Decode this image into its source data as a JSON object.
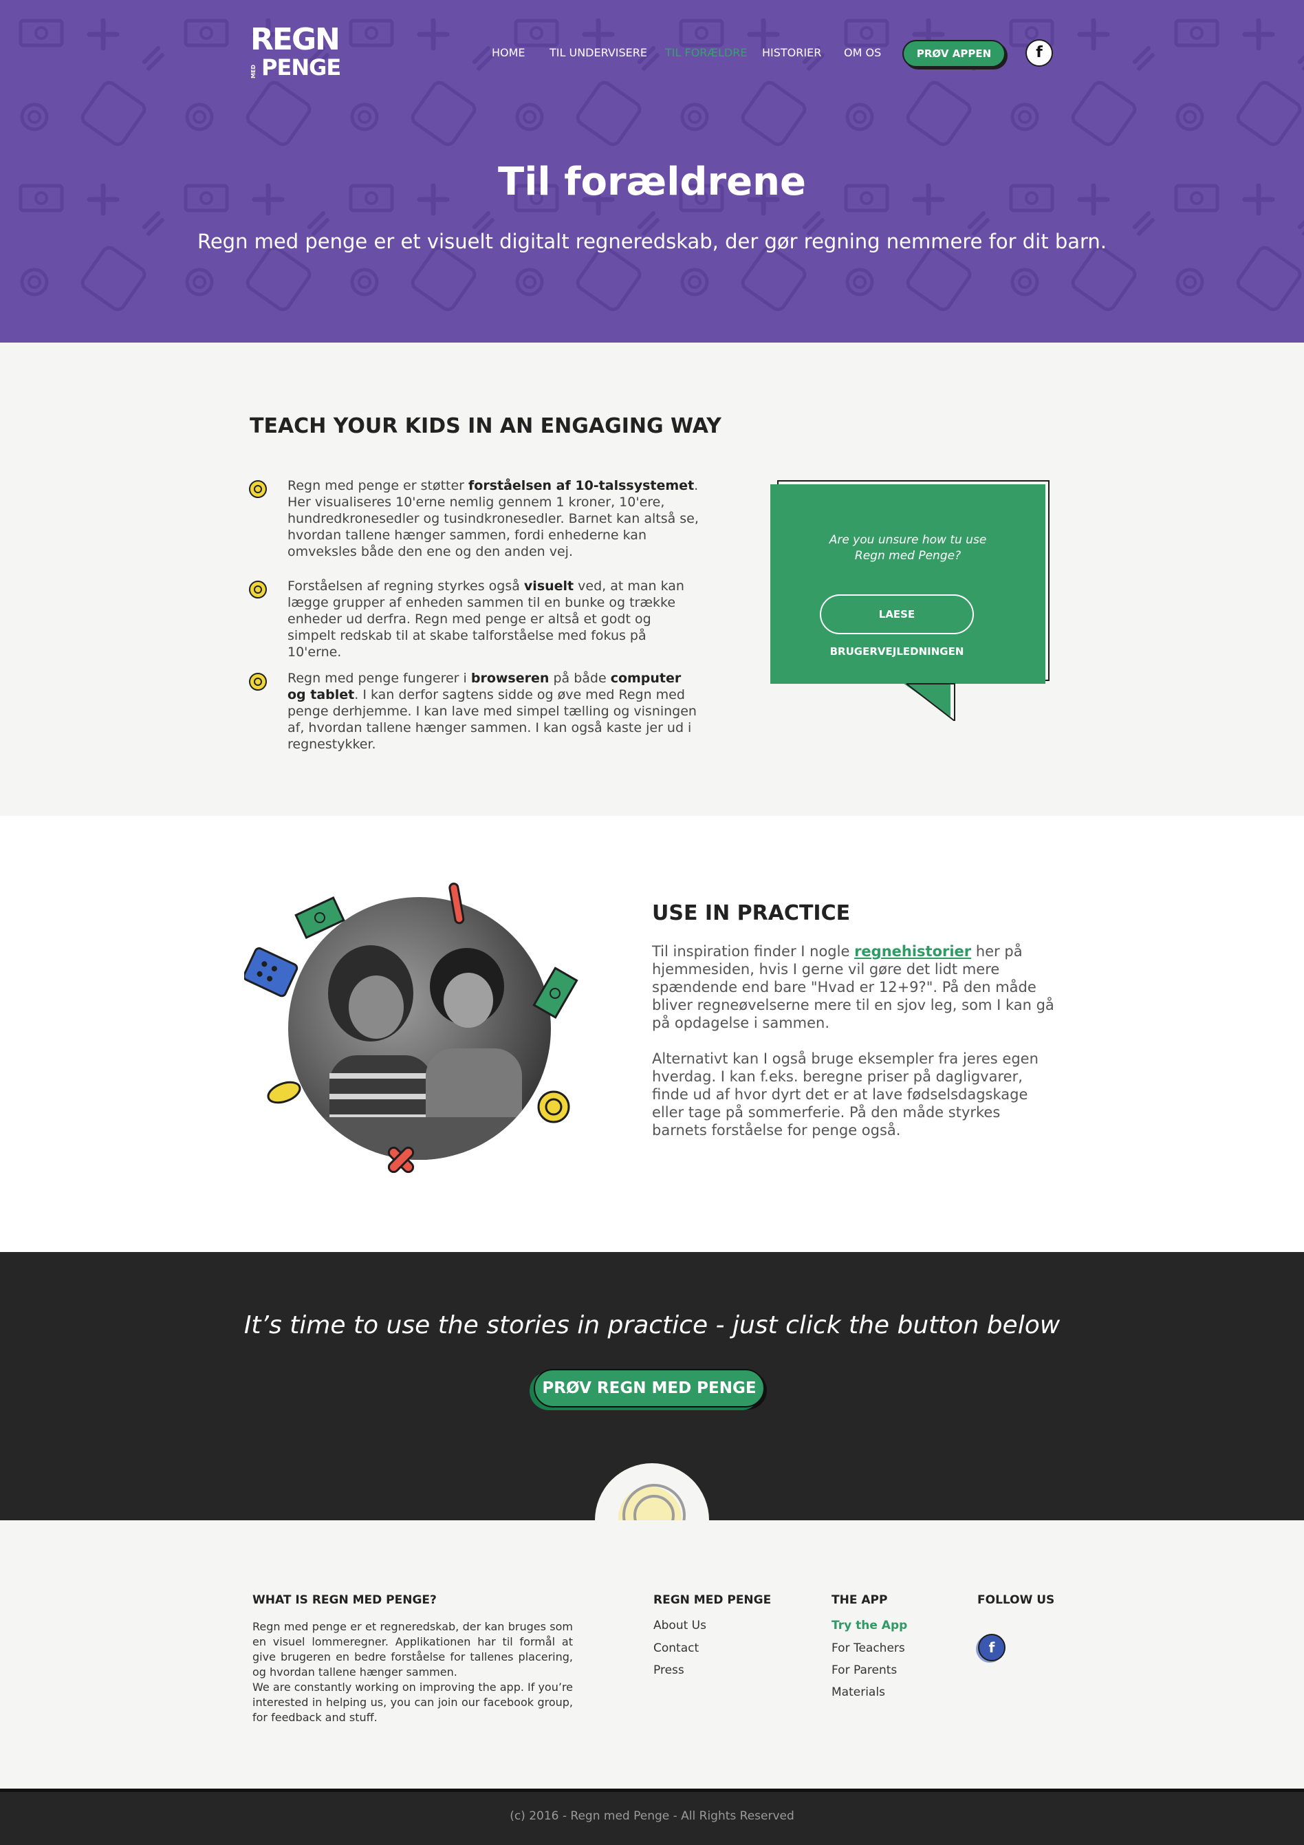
{
  "brand": {
    "logo_top": "REGN",
    "logo_small": "MED",
    "logo_bottom": "PENGE"
  },
  "nav": {
    "items": [
      {
        "label": "HOME",
        "active": false
      },
      {
        "label": "TIL UNDERVISERE",
        "active": false
      },
      {
        "label": "TIL FORÆLDRE",
        "active": true
      },
      {
        "label": "HISTORIER",
        "active": false
      },
      {
        "label": "OM OS",
        "active": false
      }
    ],
    "cta_label": "PRØV APPEN",
    "social_icon": "facebook-icon",
    "social_glyph": "f"
  },
  "hero": {
    "title": "Til forældrene",
    "subtitle": "Regn med penge er et visuelt digitalt regneredskab, der gør regning nemmere for dit barn."
  },
  "teach": {
    "heading": "TEACH YOUR KIDS IN AN ENGAGING WAY",
    "bullets": [
      {
        "pre": "Regn med penge er støtter ",
        "bold": "forståelsen af 10-talssystemet",
        "post": ". Her visualiseres 10'erne nemlig gennem 1 kroner, 10'ere, hundredkronesedler og tusindkronesedler.  Barnet kan altså se, hvordan tallene hænger sammen, fordi enhederne kan omveksles både den ene og den anden vej."
      },
      {
        "pre": "Forståelsen af regning styrkes også ",
        "bold": "visuelt",
        "post": " ved, at man kan lægge grupper af enheden sammen til en bunke og trække enheder ud derfra.  Regn med penge er altså et godt og simpelt redskab til at skabe talforståelse med fokus på 10'erne."
      },
      {
        "pre": "Regn med penge fungerer i ",
        "bold": "browseren",
        "mid": " på både ",
        "bold2": "computer og tablet",
        "post": ". I kan derfor sagtens sidde og øve med Regn med penge derhjemme. I kan lave med simpel tælling og visningen af, hvordan tallene hænger sammen. I kan også kaste jer ud i regnestykker."
      }
    ],
    "bubble_question_1": "Are you unsure how tu use",
    "bubble_question_2": "Regn med Penge?",
    "bubble_button": "LAESE BRUGERVEJLEDNINGEN"
  },
  "practice": {
    "heading": "USE IN PRACTICE",
    "p1_pre": "Til inspiration finder I nogle ",
    "p1_link": "regnehistorier",
    "p1_post": " her på hjemmesiden, hvis I gerne vil gøre det lidt mere spændende end bare \"Hvad er 12+9?\".  På den måde bliver regneøvelserne mere til en sjov leg, som I kan gå på opdagelse i sammen.",
    "p2": "Alternativt kan I også bruge eksempler fra jeres egen hverdag. I kan f.eks. beregne priser på dagligvarer, finde ud af hvor dyrt det er at lave fødselsdagskage eller tage på sommerferie. På den måde styrkes barnets forståelse for penge også."
  },
  "cta": {
    "text": "It’s time to use the stories in practice - just click the button below",
    "button": "PRØV REGN MED PENGE"
  },
  "footer": {
    "about_title": "WHAT IS REGN MED PENGE?",
    "about_text_1": "Regn med penge er et regneredskab, der kan bruges som en visuel lommeregner. Applikationen har til formål at give brugeren en bedre forståelse for tallenes placering, og hvordan tallene hænger sammen.",
    "about_text_2": "We are constantly working on improving the app. If you’re interested in helping us, you can join our facebook group, for feedback and stuff.",
    "col1_title": "REGN MED PENGE",
    "col1_links": [
      "About Us",
      "Contact",
      "Press"
    ],
    "col2_title": "THE APP",
    "col2_links": [
      "Try the App",
      "For Teachers",
      "For Parents",
      "Materials"
    ],
    "col3_title": "FOLLOW US",
    "social_glyph": "f",
    "copyright": "(c)  2016 - Regn med Penge  - All Rights Reserved"
  },
  "colors": {
    "purple": "#6a4fa6",
    "green": "#2f9a64",
    "dark": "#262626",
    "light": "#f5f5f4",
    "coin": "#f1d639"
  }
}
